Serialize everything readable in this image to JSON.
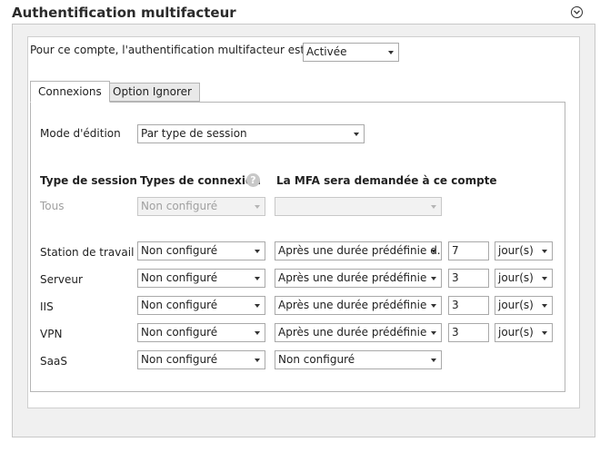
{
  "header": {
    "title": "Authentification multifacteur"
  },
  "account": {
    "label": "Pour ce compte, l'authentification multifacteur est",
    "status_value": "Activée"
  },
  "tabs": [
    {
      "label": "Connexions",
      "active": true
    },
    {
      "label": "Option Ignorer",
      "active": false
    }
  ],
  "edit_mode": {
    "label": "Mode d'édition",
    "value": "Par type de session"
  },
  "columns": {
    "session_type": "Type de session",
    "connection_types": "Types de connexion",
    "help_glyph": "?",
    "mfa_required": "La MFA sera demandée à ce compte"
  },
  "rows": [
    {
      "name": "Tous",
      "connection": "Non configuré",
      "mfa": "",
      "days": "",
      "unit": ""
    },
    {
      "name": "Station de travail",
      "connection": "Non configuré",
      "mfa": "Après une durée prédéfinie d...",
      "days": "7",
      "unit": "jour(s)"
    },
    {
      "name": "Serveur",
      "connection": "Non configuré",
      "mfa": "Après une durée prédéfinie",
      "days": "3",
      "unit": "jour(s)"
    },
    {
      "name": "IIS",
      "connection": "Non configuré",
      "mfa": "Après une durée prédéfinie",
      "days": "3",
      "unit": "jour(s)"
    },
    {
      "name": "VPN",
      "connection": "Non configuré",
      "mfa": "Après une durée prédéfinie",
      "days": "3",
      "unit": "jour(s)"
    },
    {
      "name": "SaaS",
      "connection": "Non configuré",
      "mfa": "Non configuré",
      "days": "",
      "unit": ""
    }
  ],
  "icons": {
    "collapse": "chevron-down-circle-icon",
    "help": "question-circle-icon"
  }
}
